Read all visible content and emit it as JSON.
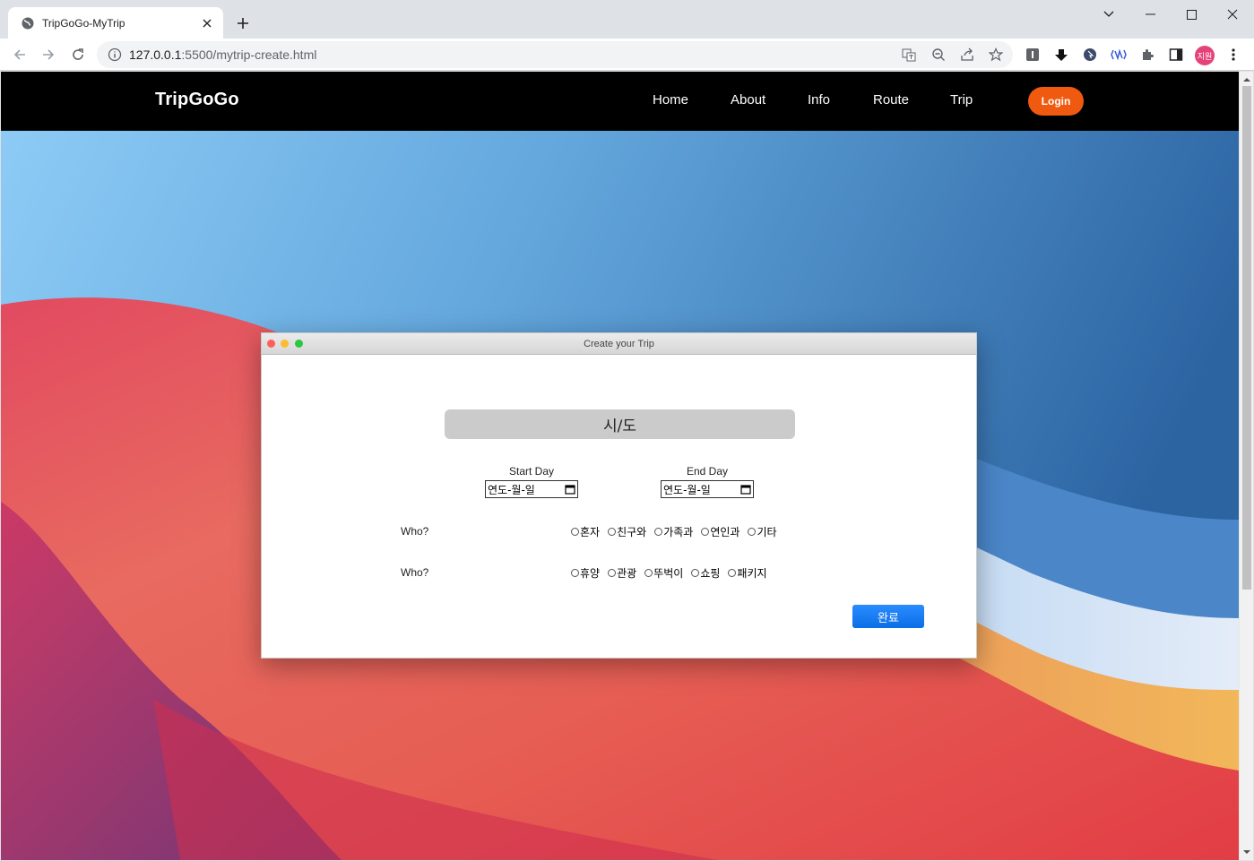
{
  "browser": {
    "tab_title": "TripGoGo-MyTrip",
    "url_host": "127.0.0.1",
    "url_path": ":5500/mytrip-create.html",
    "profile_initials": "지원"
  },
  "navbar": {
    "brand": "TripGoGo",
    "links": [
      "Home",
      "About",
      "Info",
      "Route",
      "Trip"
    ],
    "login_label": "Login"
  },
  "window": {
    "title": "Create your Trip",
    "region_button": "시/도",
    "start_label": "Start Day",
    "end_label": "End Day",
    "start_value": "연도-월-일",
    "end_value": "연도-월-일",
    "row1_label": "Who?",
    "row1_options": [
      "혼자",
      "친구와",
      "가족과",
      "연인과",
      "기타"
    ],
    "row2_label": "Who?",
    "row2_options": [
      "휴양",
      "관광",
      "뚜벅이",
      "쇼핑",
      "패키지"
    ],
    "done_label": "완료"
  },
  "colors": {
    "nav_bg": "#000000",
    "login_bg": "#f05a10",
    "done_bg": "#0a6ee6",
    "region_bg": "#cbcbcb"
  }
}
